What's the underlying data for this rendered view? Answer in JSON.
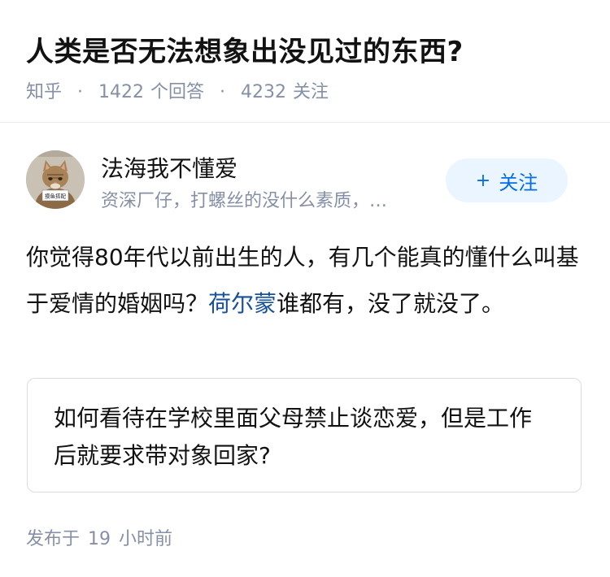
{
  "question": {
    "title": "人类是否无法想象出没见过的东西?",
    "source": "知乎",
    "separator": "·",
    "answers_count": "1422",
    "answers_label": "个回答",
    "followers_count": "4232",
    "followers_label": "关注"
  },
  "author": {
    "name": "法海我不懂爱",
    "bio": "资深厂仔，打螺丝的没什么素质，…",
    "avatar_sign_text": "摸鱼搭配",
    "follow_plus": "+",
    "follow_label": "关注"
  },
  "answer": {
    "text_before": "你觉得80年代以前出生的人，有几个能真的懂什么叫基于爱情的婚姻吗？",
    "link_text": "荷尔蒙",
    "text_after": "谁都有，没了就没了。"
  },
  "related_question": {
    "text": "如何看待在学校里面父母禁止谈恋爱，但是工作后就要求带对象回家?"
  },
  "publish": {
    "label": "发布于",
    "time_value": "19",
    "time_unit": "小时前"
  },
  "colors": {
    "link": "#175199",
    "follow_text": "#056de8",
    "follow_bg": "#ebf5ff",
    "meta_gray": "#8590a6"
  }
}
